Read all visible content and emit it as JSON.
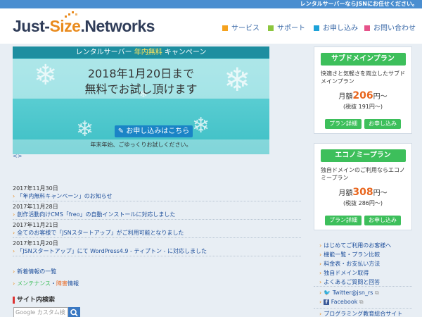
{
  "topbar": {
    "text": "レンタルサーバーならJSNにお任せください。"
  },
  "logo": {
    "part1": "Just-",
    "part2": "Size",
    "part3": ".Networks"
  },
  "nav": [
    {
      "label": "サービス",
      "color": "#f5a21e"
    },
    {
      "label": "サポート",
      "color": "#8cc63e"
    },
    {
      "label": "お申し込み",
      "color": "#1da2d8"
    },
    {
      "label": "お問い合わせ",
      "color": "#e6538a"
    }
  ],
  "banner": {
    "head_prefix": "レンタルサーバー",
    "head_highlight": "年内無料",
    "head_suffix": "キャンペーン",
    "line1": "2018年1月20日まで",
    "line2": "無料でお試し頂けます",
    "button": "お申し込みはこちら",
    "sub": "年末年始、ごゆっくりお試しください。",
    "arrows": "<>"
  },
  "news": [
    {
      "date": "2017年11月30日",
      "title": "「年内無料キャンペーン」のお知らせ"
    },
    {
      "date": "2017年11月28日",
      "title": "創作活動向けCMS「freo」の自動インストールに対応しました"
    },
    {
      "date": "2017年11月21日",
      "title": "全てのお客様で「JSNスタートアップ」がご利用可能となりました"
    },
    {
      "date": "2017年11月20日",
      "title": "「JSNスタートアップ」にて WordPress4.9 - ティプトン - に対応しました"
    }
  ],
  "news_list_link": "新着情報の一覧",
  "maintenance_link": {
    "part1": "メンテナンス",
    "sep": "・",
    "part2": "障害",
    "part3": "情報"
  },
  "site_search": {
    "title": "サイト内検索",
    "placeholder": "Google カスタム検索"
  },
  "plans": [
    {
      "title": "サブドメインプラン",
      "desc": "快適さと気軽さを両立したサブドメインプラン",
      "prefix": "月額",
      "price": "206",
      "suffix": "円〜",
      "tax": "(税抜 191円〜)",
      "btn1": "プラン詳細",
      "btn2": "お申し込み"
    },
    {
      "title": "エコノミープラン",
      "desc": "独自ドメインのご利用ならエコノミープラン",
      "prefix": "月額",
      "price": "308",
      "suffix": "円〜",
      "tax": "(税抜 286円〜)",
      "btn1": "プラン詳細",
      "btn2": "お申し込み"
    }
  ],
  "side_links": [
    "はじめてご利用のお客様へ",
    "機能一覧・プラン比較",
    "料金表・お支払い方法",
    "独自ドメイン取得",
    "よくあるご質問と回答"
  ],
  "social": [
    {
      "label": "Twitter@jsn_rs",
      "icon": "twitter-icon"
    },
    {
      "label": "Facebook",
      "icon": "facebook-icon"
    }
  ],
  "bottom_link": "プログラミング教育総合サイト",
  "colors": {
    "accent": "#3dbf5b",
    "link": "#1e4f9b",
    "price": "#e8661e",
    "topbar": "#4a8ed0"
  }
}
